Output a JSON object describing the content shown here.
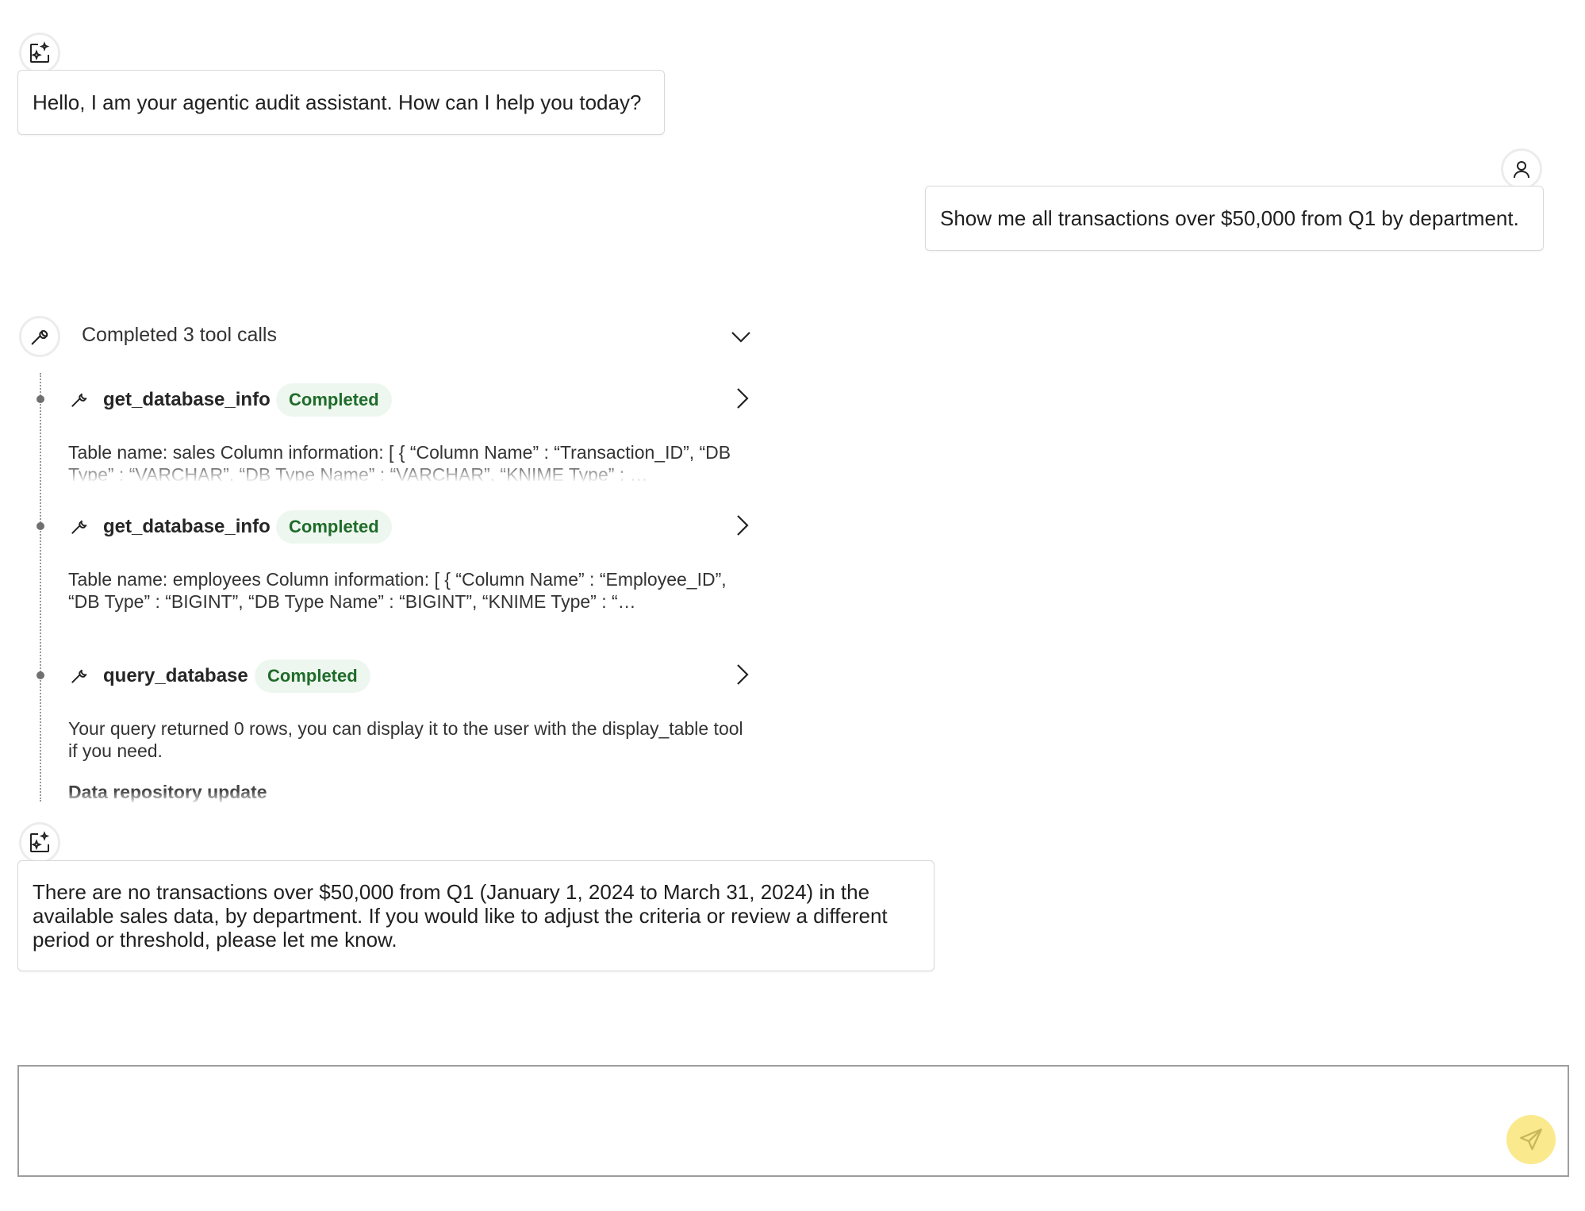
{
  "messages": {
    "greeting": "Hello, I am your agentic audit assistant. How can I help you today?",
    "user_query": "Show me all transactions over $50,000 from Q1 by department.",
    "answer": "There are no transactions over $50,000 from Q1 (January 1, 2024 to March 31, 2024) in the available sales data, by department. If you would like to adjust the criteria or review a different period or threshold, please let me know."
  },
  "tool_calls": {
    "summary": "Completed 3 tool calls",
    "items": [
      {
        "name": "get_database_info",
        "status": "Completed",
        "result": "Table name: sales Column information: [ { “Column Name” : “Transaction_ID”, “DB Type” : “VARCHAR”, “DB Type Name” : “VARCHAR”, “KNIME Type” : …"
      },
      {
        "name": "get_database_info",
        "status": "Completed",
        "result": "Table name: employees Column information: [ { “Column Name” : “Employee_ID”, “DB Type” : “BIGINT”, “DB Type Name” : “BIGINT”, “KNIME Type” : “…"
      },
      {
        "name": "query_database",
        "status": "Completed",
        "result": "Your query returned 0 rows, you can display it to the user with the display_table tool if you need."
      }
    ],
    "repo_update": "Data repository update"
  },
  "input": {
    "placeholder": ""
  },
  "icons": {
    "assistant": "sparkle-image-icon",
    "user": "user-icon",
    "tool": "wrench-icon",
    "expand": "chevron-down-icon",
    "open": "chevron-right-icon",
    "send": "send-icon"
  },
  "colors": {
    "badge_bg": "#eef7ef",
    "badge_text": "#1f6b2a",
    "send_button": "#fbe98e"
  }
}
